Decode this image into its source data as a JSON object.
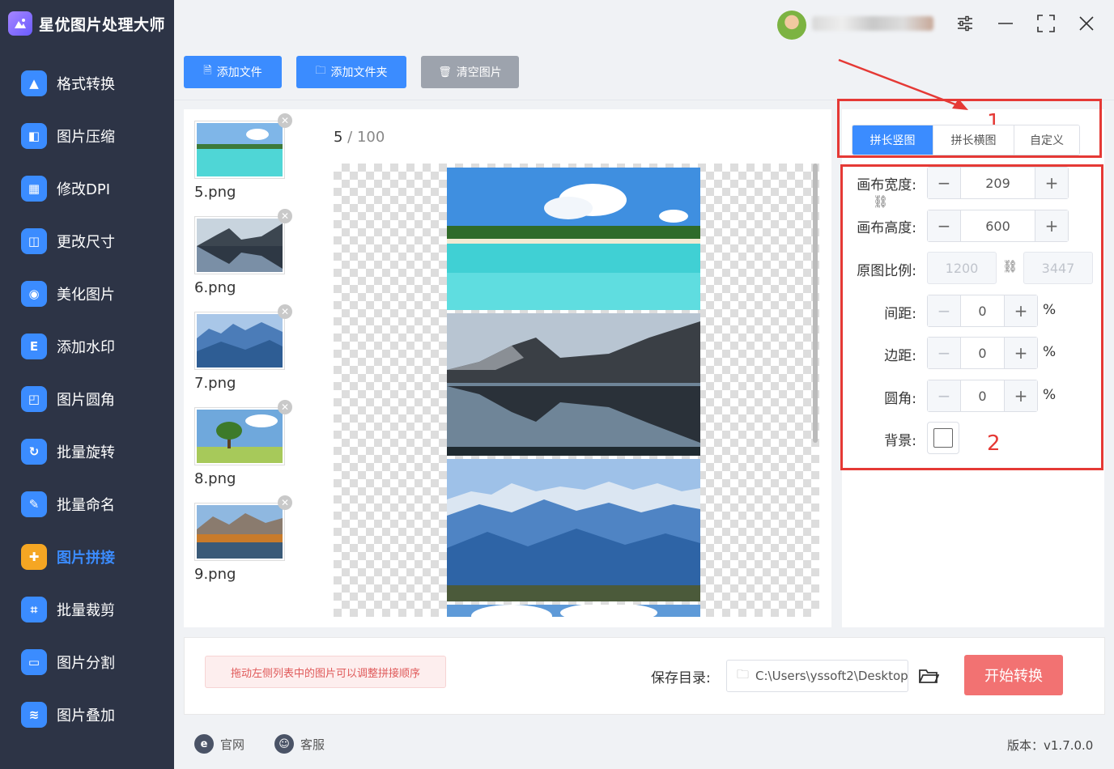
{
  "app": {
    "title": "星优图片处理大师"
  },
  "sidebar": {
    "items": [
      {
        "label": "格式转换",
        "icon": "image-icon",
        "color": "#3b8cff",
        "glyph": "▲"
      },
      {
        "label": "图片压缩",
        "icon": "compress-icon",
        "color": "#3b8cff",
        "glyph": "◧"
      },
      {
        "label": "修改DPI",
        "icon": "dpi-icon",
        "color": "#3b8cff",
        "glyph": "▦"
      },
      {
        "label": "更改尺寸",
        "icon": "resize-icon",
        "color": "#3b8cff",
        "glyph": "◫"
      },
      {
        "label": "美化图片",
        "icon": "beautify-icon",
        "color": "#3b8cff",
        "glyph": "◉"
      },
      {
        "label": "添加水印",
        "icon": "watermark-icon",
        "color": "#3b8cff",
        "glyph": "E"
      },
      {
        "label": "图片圆角",
        "icon": "round-corner-icon",
        "color": "#3b8cff",
        "glyph": "◰"
      },
      {
        "label": "批量旋转",
        "icon": "rotate-icon",
        "color": "#3b8cff",
        "glyph": "↻"
      },
      {
        "label": "批量命名",
        "icon": "rename-icon",
        "color": "#3b8cff",
        "glyph": "✎"
      },
      {
        "label": "图片拼接",
        "icon": "puzzle-icon",
        "color": "#f5a623",
        "glyph": "✚"
      },
      {
        "label": "批量裁剪",
        "icon": "crop-icon",
        "color": "#3b8cff",
        "glyph": "⌗"
      },
      {
        "label": "图片分割",
        "icon": "split-icon",
        "color": "#3b8cff",
        "glyph": "▭"
      },
      {
        "label": "图片叠加",
        "icon": "layers-icon",
        "color": "#3b8cff",
        "glyph": "≋"
      }
    ],
    "active_index": 9
  },
  "toolbar": {
    "add_file": "添加文件",
    "add_folder": "添加文件夹",
    "clear": "清空图片"
  },
  "files": {
    "items": [
      {
        "name": "5.png"
      },
      {
        "name": "6.png"
      },
      {
        "name": "7.png"
      },
      {
        "name": "8.png"
      },
      {
        "name": "9.png"
      }
    ],
    "count_current": "5",
    "count_sep": " / ",
    "count_total": "100"
  },
  "settings": {
    "tabs": [
      "拼长竖图",
      "拼长横图",
      "自定义"
    ],
    "active_tab": 0,
    "canvas_width_label": "画布宽度:",
    "canvas_width": "209",
    "canvas_height_label": "画布高度:",
    "canvas_height": "600",
    "ratio_label": "原图比例:",
    "ratio_w": "1200",
    "ratio_h": "3447",
    "spacing_label": "间距:",
    "spacing": "0",
    "margin_label": "边距:",
    "margin": "0",
    "radius_label": "圆角:",
    "radius": "0",
    "percent": "%",
    "background_label": "背景:",
    "annotation_1": "1",
    "annotation_2": "2"
  },
  "bottom": {
    "hint": "拖动左侧列表中的图片可以调整拼接顺序",
    "save_label": "保存目录:",
    "save_path": "C:\\Users\\yssoft2\\Desktop",
    "start": "开始转换"
  },
  "footer": {
    "website": "官网",
    "support": "客服",
    "version": "版本：v1.7.0.0"
  },
  "colors": {
    "accent": "#3b8cff",
    "sidebar_bg": "#2d3446",
    "start_button": "#f27272",
    "annotation_red": "#e53935"
  }
}
